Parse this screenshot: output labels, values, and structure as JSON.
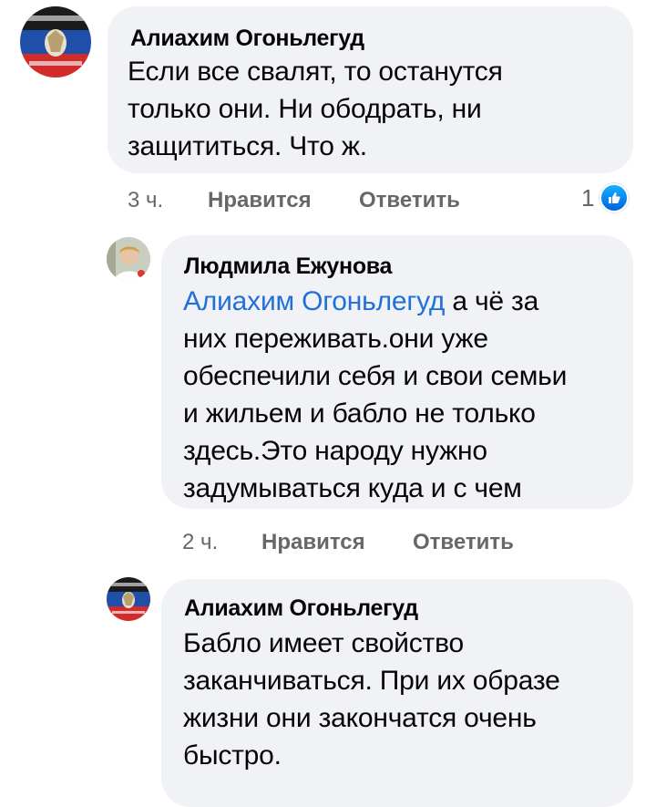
{
  "comments": [
    {
      "author": "Алиахим Огоньлегуд",
      "lines": [
        "Если все свалят, то останутся",
        "только они. Ни ободрать, ни",
        "защититься. Что ж."
      ],
      "time": "3 ч.",
      "like_label": "Нравится",
      "reply_label": "Ответить",
      "reaction_count": "1"
    },
    {
      "author": "Людмила Ежунова",
      "mention": "Алиахим Огоньлегуд",
      "lines": [
        "а чё за",
        "них переживать.они уже",
        "обеспечили себя и свои семьи",
        "и жильем и бабло не только",
        "здесь.Это народу нужно",
        "задумываться куда  и с чем"
      ],
      "time": "2 ч.",
      "like_label": "Нравится",
      "reply_label": "Ответить"
    },
    {
      "author": "Алиахим Огоньлегуд",
      "lines": [
        "Бабло имеет свойство",
        "заканчиваться. При их образе",
        "жизни они закончатся очень",
        "быстро."
      ]
    }
  ],
  "colors": {
    "bubble": "#f0f2f5",
    "mention": "#216fdb",
    "meta": "#65676b",
    "like_badge": "#1877f2"
  },
  "icons": {
    "like_reaction": "thumbs-up-icon",
    "avatar_1": "flag-avatar",
    "avatar_2": "person-avatar"
  }
}
